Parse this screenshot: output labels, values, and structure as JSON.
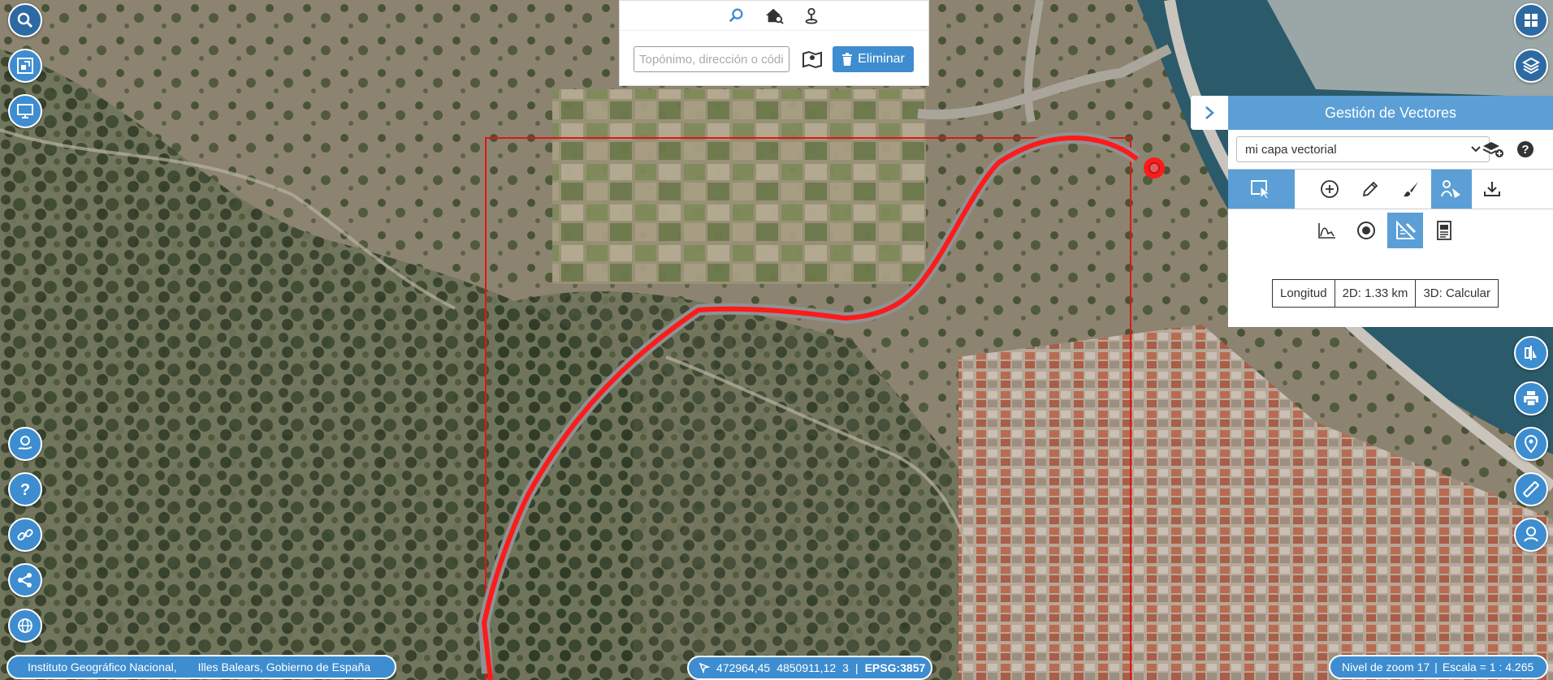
{
  "search": {
    "placeholder": "Topónimo, dirección o código",
    "delete_label": "Eliminar"
  },
  "vector_panel": {
    "title": "Gestión de Vectores",
    "layer": "mi capa vectorial",
    "measure": {
      "label": "Longitud",
      "value_2d": "2D: 1.33 km",
      "value_3d": "3D: Calcular"
    }
  },
  "footer": {
    "attribution_1": "Instituto Geográfico Nacional,",
    "attribution_2": "Illes Balears, Gobierno de España",
    "coord_x": "472964,45",
    "coord_y": "4850911,12",
    "coord_dim": "3",
    "epsg": "EPSG:3857",
    "zoom_level": "Nivel de zoom 17",
    "scale": "Escala = 1 : 4.265"
  },
  "colors": {
    "accent": "#3d8dd0",
    "panel_header": "#5b9fd6",
    "route": "#ff1a1a"
  },
  "icons": {
    "left_toolbar": [
      "zoom-search-icon",
      "extent-icon",
      "screen-icon",
      "hand-info-icon",
      "help-icon",
      "link-icon",
      "share-icon",
      "globe-icon"
    ],
    "right_toolbar": [
      "grid-icon",
      "layers-icon",
      "compare-icon",
      "print-icon",
      "location-info-icon",
      "ruler-icon",
      "advanced-search-icon"
    ]
  }
}
